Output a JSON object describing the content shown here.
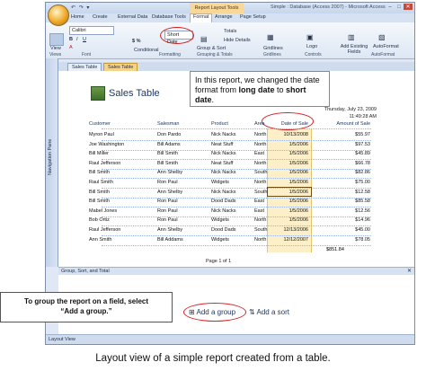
{
  "window": {
    "contextual_title": "Report Layout Tools",
    "title": "Simple : Database (Access 2007) - Microsoft Access",
    "qat": "↶ ↷ ▾"
  },
  "ribbon": {
    "tabs": [
      "Home",
      "Create",
      "External Data",
      "Database Tools",
      "Format",
      "Arrange",
      "Page Setup"
    ],
    "view_label": "View",
    "views_group": "Views",
    "font_name": "Calibri",
    "font_group": "Font",
    "format_box": "Short Date",
    "conditional": "Conditional",
    "format_group": "Formatting",
    "group_sort": "Group & Sort",
    "totals": "Totals",
    "hide_details": "Hide Details",
    "grouping_group": "Grouping & Totals",
    "gridlines": "Gridlines",
    "gridlines_group": "Gridlines",
    "logo": "Logo",
    "controls_group": "Controls",
    "add_fields": "Add Existing Fields",
    "autoformat": "AutoFormat",
    "autoformat_group": "AutoFormat"
  },
  "doc_tabs": [
    "Sales Table",
    "Sales Table"
  ],
  "navpane_label": "Navigation Pane",
  "callout": {
    "line1": "In this report, we changed the date",
    "line2a": "format from ",
    "line2b": "long date",
    "line2c": " to ",
    "line2d": "short date",
    "line2e": "."
  },
  "report": {
    "title": "Sales Table",
    "date": "Thursday, July 23, 2009",
    "time": "11:49:28 AM",
    "headers": [
      "Customer",
      "Salesman",
      "Product",
      "Area",
      "Date of Sale",
      "Amount of Sale"
    ],
    "rows": [
      [
        "Myron Paul",
        "Don Pardo",
        "Nick Nacks",
        "North",
        "10/13/2008",
        "$55.97"
      ],
      [
        "Joe Washington",
        "Bill Adams",
        "Neat Stuff",
        "North",
        "1/5/2006",
        "$97.53"
      ],
      [
        "Bill Miller",
        "Bill Smith",
        "Nick Nacks",
        "East",
        "1/5/2006",
        "$45.89"
      ],
      [
        "Raul Jefferson",
        "Bill Smith",
        "Neat Stuff",
        "North",
        "1/5/2006",
        "$66.78"
      ],
      [
        "Bill Smith",
        "Ann Shelby",
        "Nick Nacks",
        "South",
        "1/5/2006",
        "$82.86"
      ],
      [
        "Raul Smith",
        "Ron Paul",
        "Widgets",
        "North",
        "1/5/2006",
        "$75.00"
      ],
      [
        "Bill Smith",
        "Ann Shelby",
        "Nick Nacks",
        "South",
        "1/5/2006",
        "$12.58"
      ],
      [
        "Bill Smith",
        "Ron Paul",
        "Dood Dads",
        "East",
        "1/5/2006",
        "$85.58"
      ],
      [
        "Mabel Jones",
        "Ron Paul",
        "Nick Nacks",
        "East",
        "1/5/2006",
        "$12.56"
      ],
      [
        "Bob Ortiz",
        "Ron Paul",
        "Widgets",
        "North",
        "1/5/2006",
        "$14.96"
      ],
      [
        "Raul Jefferson",
        "Ann Shelby",
        "Dood Dads",
        "South",
        "12/13/2006",
        "$45.00"
      ],
      [
        "Ann Smith",
        "Bill Addams",
        "Widgets",
        "North",
        "12/12/2007",
        "$78.05"
      ]
    ],
    "total": "$851.84",
    "page": "Page 1 of 1"
  },
  "gsp": {
    "header": "Group, Sort, and Total",
    "add_group": "Add a group",
    "add_sort": "Add a sort"
  },
  "group_callout": {
    "line1": "To group the report on a field, select",
    "line2": "“Add a group.”"
  },
  "status": "Layout View",
  "caption": "Layout view of a simple report created from a table."
}
